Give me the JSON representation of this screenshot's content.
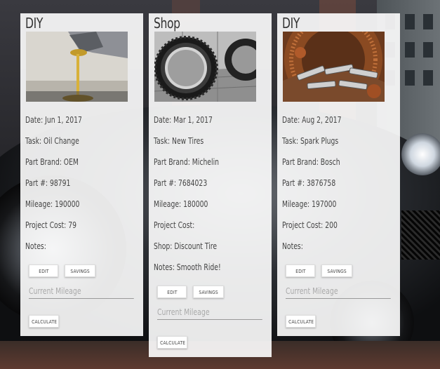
{
  "cards": [
    {
      "category": "DIY",
      "photo": "oil-pour-photo",
      "date": "Date: Jun 1, 2017",
      "task": "Task: Oil Change",
      "part_brand": "Part Brand: OEM",
      "part_number": "Part #: 98791",
      "mileage": "Mileage: 190000",
      "project_cost": "Project Cost: 79",
      "notes": "Notes:",
      "edit_label": "EDIT",
      "savings_label": "SAVINGS",
      "mileage_placeholder": "Current Mileage",
      "calculate_label": "CALCULATE"
    },
    {
      "category": "Shop",
      "photo": "tire-photo",
      "date": "Date: Mar 1, 2017",
      "task": "Task: New Tires",
      "part_brand": "Part Brand: Michelin",
      "part_number": "Part #: 7684023",
      "mileage": "Mileage: 180000",
      "project_cost": "Project Cost:",
      "shop": "Shop: Discount Tire",
      "notes": "Notes: Smooth Ride!",
      "edit_label": "EDIT",
      "savings_label": "SAVINGS",
      "mileage_placeholder": "Current Mileage",
      "calculate_label": "CALCULATE"
    },
    {
      "category": "DIY",
      "photo": "spark-plugs-photo",
      "date": "Date: Aug 2, 2017",
      "task": "Task: Spark Plugs",
      "part_brand": "Part Brand: Bosch",
      "part_number": "Part #: 3876758",
      "mileage": "Mileage: 197000",
      "project_cost": "Project Cost: 200",
      "notes": "Notes:",
      "edit_label": "EDIT",
      "savings_label": "SAVINGS",
      "mileage_placeholder": "Current Mileage",
      "calculate_label": "CALCULATE"
    }
  ]
}
